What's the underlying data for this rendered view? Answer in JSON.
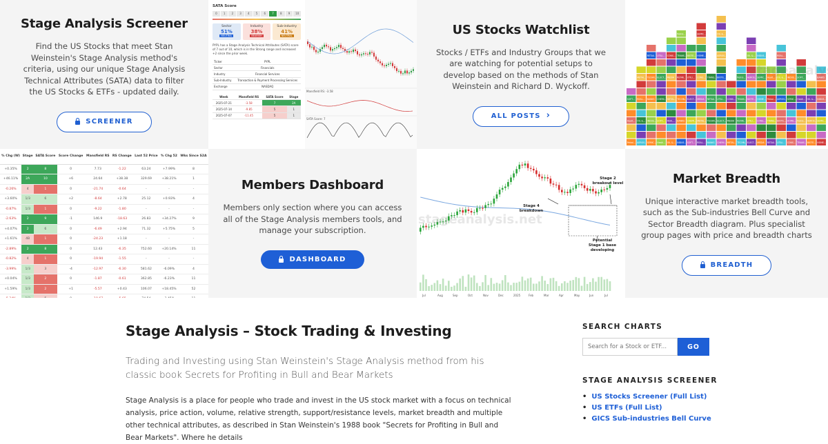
{
  "screener_tile": {
    "title": "Stage Analysis Screener",
    "desc": "Find the US Stocks that meet Stan Weinstein's Stage Analysis method's criteria, using our unique Stage Analysis Technical Attributes (SATA) data to filter the US Stocks & ETFs - updated daily.",
    "button": "SCREENER"
  },
  "watchlist_tile": {
    "title": "US Stocks Watchlist",
    "desc": "Stocks / ETFs and Industry Groups that we are watching for potential setups to develop based on the methods of Stan Weinstein and Richard D. Wyckoff.",
    "button": "ALL POSTS",
    "arrow": "›"
  },
  "members_tile": {
    "title": "Members Dashboard",
    "desc": "Members only section where you can access all of the Stage Analysis members tools, and manage your subscription.",
    "button": "DASHBOARD"
  },
  "breadth_tile": {
    "title": "Market Breadth",
    "desc": "Unique interactive market breadth tools, such as the Sub-industries Bell Curve and Sector Breadth diagram. Plus specialist group pages with price and breadth charts",
    "button": "BREADTH"
  },
  "sata_card": {
    "title": "SATA Score",
    "scale": [
      "0",
      "1",
      "2",
      "3",
      "4",
      "5",
      "6",
      "7",
      "8",
      "9",
      "10"
    ],
    "active_score": "7",
    "sector": {
      "label": "Sector",
      "value": "51%",
      "tag": "NEUTRAL"
    },
    "industry": {
      "label": "Industry",
      "value": "38%",
      "tag": "BEARISH"
    },
    "subindustry": {
      "label": "Sub-industry",
      "value": "41%",
      "tag": "NEUTRAL"
    },
    "note": "PYPL has a Stage Analysis Technical Attributes (SATA) score of 7 out of 10, which is in the Strong range and increased +2 since the prior week.",
    "rows": [
      [
        "Ticker",
        "PYPL"
      ],
      [
        "Sector",
        "Financials"
      ],
      [
        "Industry",
        "Financial Services"
      ],
      [
        "Sub-Industry",
        "Transaction & Payment Processing Services"
      ],
      [
        "Exchange",
        "NASDAQ"
      ]
    ],
    "weeks_header": [
      "Week",
      "Mansfield RS",
      "SATA Score",
      "Stage"
    ],
    "weeks": [
      [
        "2025-07-21",
        "-3.58",
        "7",
        "2A"
      ],
      [
        "2025-07-14",
        "-9.85",
        "5",
        "1"
      ],
      [
        "2025-07-07",
        "-11.45",
        "5",
        "1"
      ]
    ],
    "mansfield_label": "Mansfield RS: -3.58",
    "sata_label": "SATA Score: 7"
  },
  "screener_table": {
    "headers": [
      "% Chg (W)",
      "Stage",
      "SATA Score",
      "Score Change",
      "Mansfield RS",
      "RS Change",
      "Last 52 Price",
      "% Chg 52",
      "Wks Since S2A"
    ],
    "rows": [
      [
        "+0.35%",
        "2",
        "8",
        "0",
        "7.73",
        "-1.22",
        "63.24",
        "+7.99%",
        "8"
      ],
      [
        "+46.11%",
        "2A",
        "10",
        "+6",
        "24.64",
        "+38.38",
        "329.69",
        "+38.21%",
        "1"
      ],
      [
        "-0.26%",
        "4",
        "1",
        "0",
        "-21.74",
        "-0.64",
        "-",
        "-",
        "-"
      ],
      [
        "+3.60%",
        "1/3",
        "6",
        "+2",
        "-8.64",
        "+2.78",
        "25.12",
        "+0.93%",
        "4"
      ],
      [
        "-0.87%",
        "1/3",
        "1",
        "0",
        "-9.22",
        "-1.80",
        "-",
        "-",
        "-"
      ],
      [
        "-2.63%",
        "2",
        "9",
        "-1",
        "146.9",
        "-18.63",
        "26.83",
        "+34.27%",
        "9"
      ],
      [
        "+4.07%",
        "2",
        "6",
        "0",
        "-6.49",
        "+2.94",
        "71.32",
        "+5.75%",
        "5"
      ],
      [
        "+1.61%",
        "4B",
        "1",
        "0",
        "-24.23",
        "+1.18",
        "-",
        "-",
        "-"
      ],
      [
        "-2.89%",
        "2",
        "8",
        "0",
        "12.43",
        "-6.35",
        "752.60",
        "+20.14%",
        "11"
      ],
      [
        "-0.82%",
        "4",
        "1",
        "0",
        "-19.94",
        "-1.55",
        "-",
        "-",
        "-"
      ],
      [
        "-3.99%",
        "1/3",
        "3",
        "-4",
        "-12.97",
        "-6.30",
        "581.62",
        "-6.09%",
        "4"
      ],
      [
        "+0.04%",
        "1/3",
        "2",
        "0",
        "-1.87",
        "-0.61",
        "362.85",
        "-6.23%",
        "11"
      ],
      [
        "+1.59%",
        "1/3",
        "2",
        "+1",
        "-5.57",
        "+0.43",
        "106.07",
        "+18.45%",
        "52"
      ],
      [
        "-5.24%",
        "1/3",
        "5",
        "0",
        "-10.67",
        "-5.65",
        "74.54",
        "-3.45%",
        "11"
      ],
      [
        "+0.73%",
        "2",
        "9",
        "-1",
        "14.65",
        "-0.90",
        "82.64",
        "+16.77%",
        "13"
      ],
      [
        "-8.72%",
        "2B",
        "4",
        "-4",
        "6.97",
        "-12.12",
        "30.64",
        "+47.47%",
        "42"
      ],
      [
        "+1.77%",
        "2",
        "7",
        "0",
        "-0.83",
        "+0.93",
        "22.23",
        "+8.59%",
        "5"
      ]
    ]
  },
  "price_chart": {
    "annotation_stage2": "Stage 2 breakout level",
    "annotation_stage4": "Stage 4 breakdown",
    "annotation_base": "Potential Stage 1 base developing",
    "year_label": "2025",
    "months": [
      "Jul",
      "Aug",
      "Sep",
      "Oct",
      "Nov",
      "Dec",
      "2025",
      "Feb",
      "Mar",
      "Apr",
      "May",
      "Jun",
      "Jul"
    ]
  },
  "heatmap_labels": [
    "Petrol...",
    "AEROS...",
    "SEMIC...",
    "Healt...",
    "OIL &...",
    "INDUS...",
    "SOFT...",
    "REAL...",
    "BANKS",
    "CHEMI...",
    "METAL...",
    "TECHN...",
    "ELECT...",
    "MEDIA",
    "RETAIL",
    "UTILI...",
    "CONS...",
    "TRANS...",
    "BIOTE...",
    "HOME..."
  ],
  "watermark": "stageanalysis.net",
  "main": {
    "title": "Stage Analysis – Stock Trading & Investing",
    "lead": "Trading and Investing using Stan Weinstein's Stage Analysis method from his classic book Secrets for Profiting in Bull and Bear Markets",
    "body": "Stage Analysis is a place for people who trade and invest in the US stock market with a focus on technical analysis, price action, volume, relative strength, support/resistance levels, market breadth and multiple other technical attributes, as described in Stan Weinstein's 1988 book \"Secrets for Profiting in Bull and Bear Markets\". Where he details"
  },
  "sidebar": {
    "search_title": "SEARCH CHARTS",
    "search_placeholder": "Search for a Stock or ETF...",
    "search_button": "GO",
    "screener_title": "STAGE ANALYSIS SCREENER",
    "links": [
      "US Stocks Screener (Full List)",
      "US ETFs (Full List)",
      "GICS Sub-industries Bell Curve"
    ]
  },
  "colors": {
    "accent": "#1e5fd6",
    "tile_bg": "#f4f4f4",
    "green": "#3da75a",
    "red": "#e5726a"
  }
}
